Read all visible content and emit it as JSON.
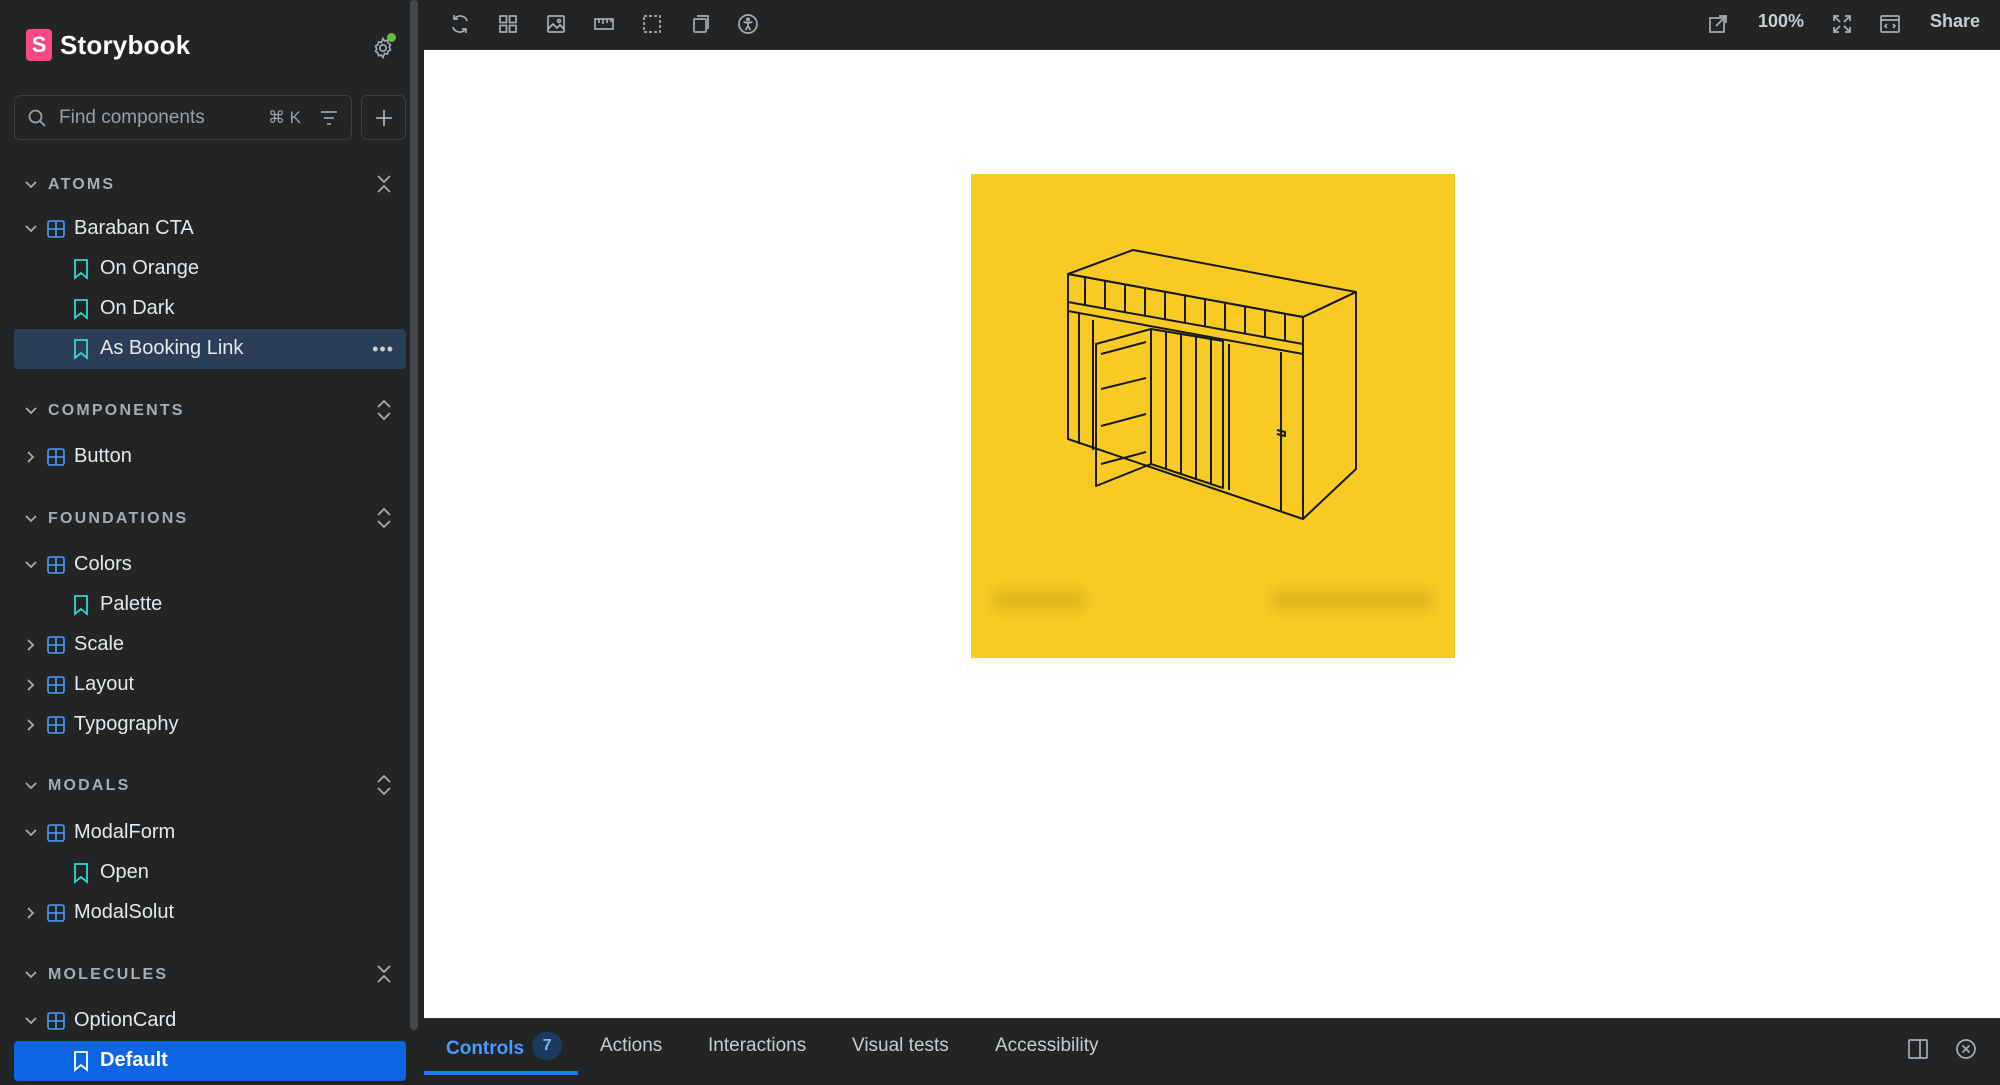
{
  "app": {
    "brand_name": "Storybook",
    "brand_letter": "S",
    "brand_color": "#ff4785",
    "accent_color": "#0c66e4",
    "status_dot_color": "#66bf3c"
  },
  "search": {
    "placeholder": "Find components",
    "shortcut": "⌘ K"
  },
  "sidebar": {
    "sections": [
      {
        "label": "ATOMS",
        "items": [
          {
            "kind": "component",
            "label": "Baraban CTA",
            "expanded": true
          },
          {
            "kind": "story",
            "label": "On Orange"
          },
          {
            "kind": "story",
            "label": "On Dark"
          },
          {
            "kind": "story",
            "label": "As Booking Link",
            "state": "hover"
          }
        ]
      },
      {
        "label": "COMPONENTS",
        "items": [
          {
            "kind": "component",
            "label": "Button",
            "expanded": false
          }
        ]
      },
      {
        "label": "FOUNDATIONS",
        "items": [
          {
            "kind": "component",
            "label": "Colors",
            "expanded": true
          },
          {
            "kind": "story",
            "label": "Palette"
          },
          {
            "kind": "component",
            "label": "Scale",
            "expanded": false
          },
          {
            "kind": "component",
            "label": "Layout",
            "expanded": false
          },
          {
            "kind": "component",
            "label": "Typography",
            "expanded": false
          }
        ]
      },
      {
        "label": "MODALS",
        "items": [
          {
            "kind": "component",
            "label": "ModalForm",
            "expanded": true
          },
          {
            "kind": "story",
            "label": "Open"
          },
          {
            "kind": "component",
            "label": "ModalSolut",
            "expanded": false
          }
        ]
      },
      {
        "label": "MOLECULES",
        "items": [
          {
            "kind": "component",
            "label": "OptionCard",
            "expanded": true
          },
          {
            "kind": "story",
            "label": "Default",
            "state": "selected"
          }
        ]
      }
    ]
  },
  "toolbar": {
    "left_icons": [
      "remount-icon",
      "grid-icon",
      "background-icon",
      "measure-icon",
      "outline-icon",
      "viewport-icon",
      "accessibility-icon"
    ],
    "right_icons": [
      "open-new-tab-icon",
      "fullscreen-icon",
      "code-icon"
    ],
    "zoom": "100%",
    "share_label": "Share"
  },
  "preview": {
    "card_color": "#f8ca24",
    "illustration": "wardrobe-line-drawing"
  },
  "addons": {
    "tabs": [
      {
        "label": "Controls",
        "badge": "7",
        "active": true
      },
      {
        "label": "Actions"
      },
      {
        "label": "Interactions"
      },
      {
        "label": "Visual tests"
      },
      {
        "label": "Accessibility"
      }
    ],
    "right_icons": [
      "panel-orientation-icon",
      "close-panel-icon"
    ]
  }
}
